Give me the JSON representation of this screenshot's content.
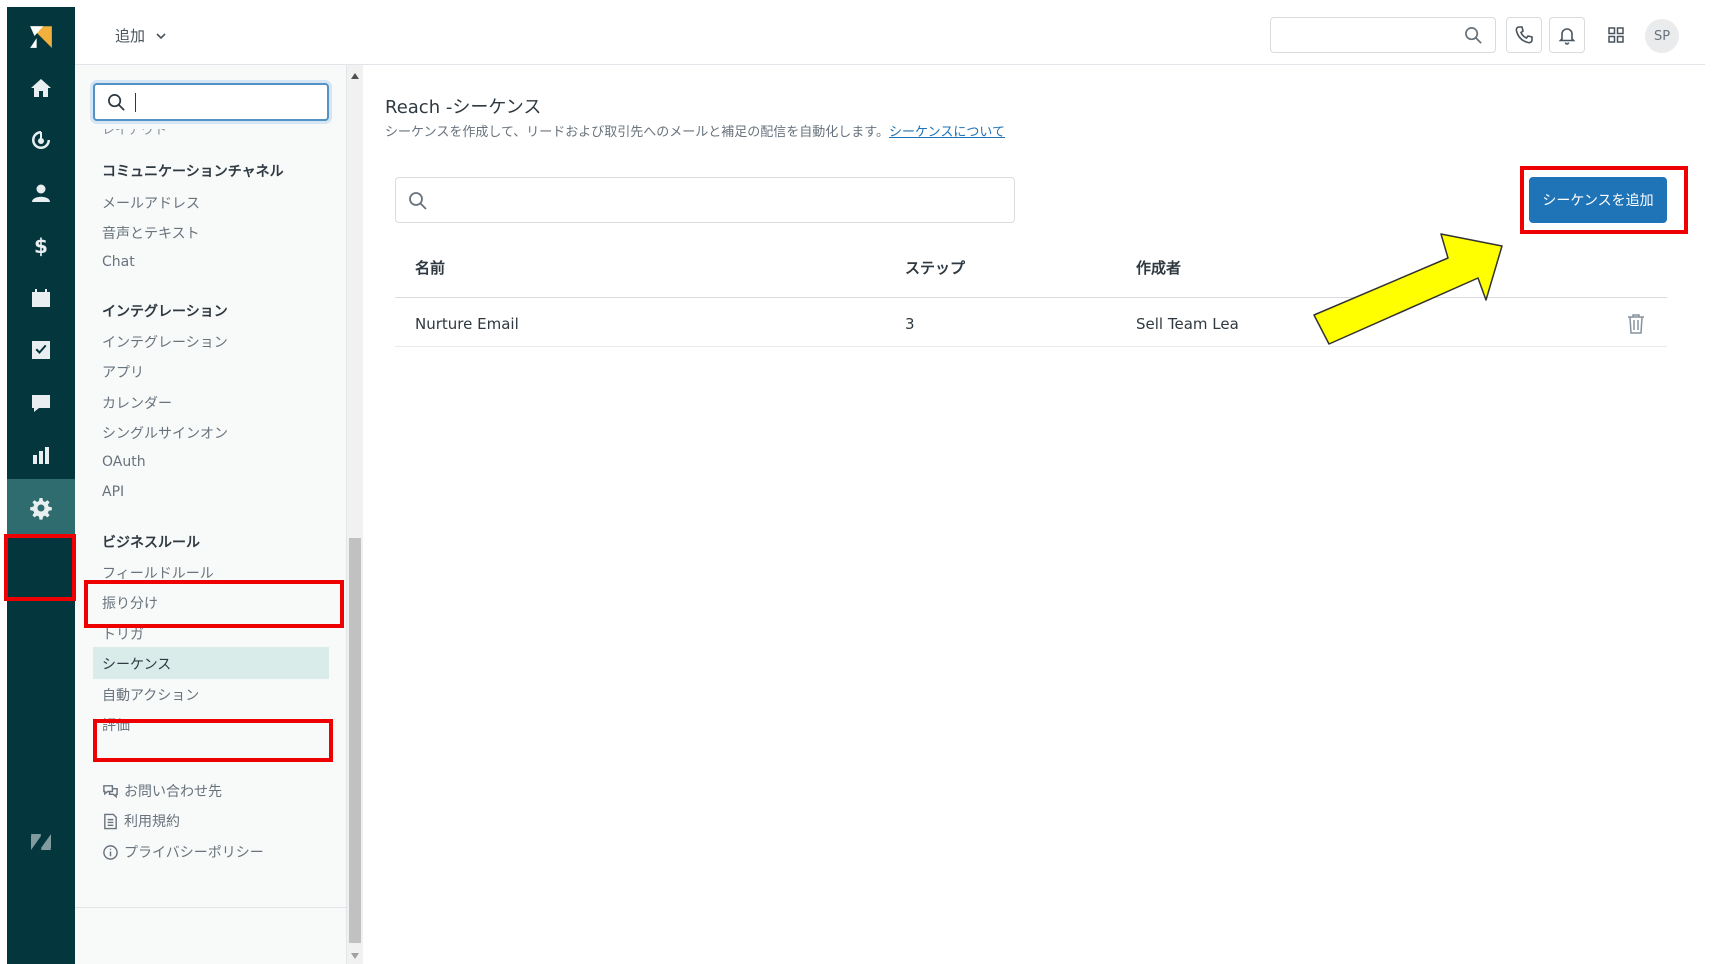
{
  "topbar": {
    "add_label": "追加",
    "avatar_initials": "SP",
    "icons": [
      "search-icon",
      "phone-icon",
      "bell-icon",
      "apps-grid-icon"
    ]
  },
  "rail": {
    "icons": [
      "logo-icon",
      "home-icon",
      "leads-icon",
      "contacts-icon",
      "deals-icon",
      "calendar-icon",
      "tasks-icon",
      "chat-icon",
      "reports-icon",
      "gear-icon",
      "zendesk-icon"
    ]
  },
  "sidebar": {
    "search_value": "",
    "clipped_label": "レイアウト",
    "sections": [
      {
        "title": "コミュニケーションチャネル",
        "items": [
          "メールアドレス",
          "音声とテキスト",
          "Chat"
        ]
      },
      {
        "title": "インテグレーション",
        "items": [
          "インテグレーション",
          "アプリ",
          "カレンダー",
          "シングルサインオン",
          "OAuth",
          "API"
        ]
      },
      {
        "title": "ビジネスルール",
        "items": [
          "フィールドルール",
          "振り分け",
          "トリガ",
          "シーケンス",
          "自動アクション",
          "評価"
        ]
      }
    ],
    "active_item": "シーケンス",
    "footer": [
      "お問い合わせ先",
      "利用規約",
      "プライバシーポリシー"
    ]
  },
  "main": {
    "title": "Reach -シーケンス",
    "description": "シーケンスを作成して、リードおよび取引先へのメールと補足の配信を自動化します。",
    "description_link": "シーケンスについて",
    "search_value": "",
    "add_button": "シーケンスを追加",
    "table": {
      "columns": [
        "名前",
        "ステップ",
        "作成者"
      ],
      "rows": [
        {
          "name": "Nurture Email",
          "steps": "3",
          "author": "Sell Team Lea"
        }
      ]
    }
  },
  "colors": {
    "rail_bg": "#03363d",
    "primary": "#1f73b7",
    "highlight": "#ee0000",
    "arrow_fill": "#ffff00"
  }
}
